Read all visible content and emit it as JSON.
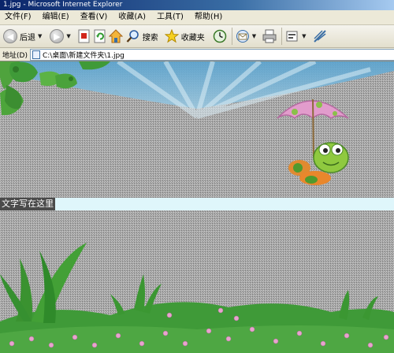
{
  "window": {
    "title": "1.jpg - Microsoft Internet Explorer"
  },
  "menu": {
    "items": [
      "文件(F)",
      "编辑(E)",
      "查看(V)",
      "收藏(A)",
      "工具(T)",
      "帮助(H)"
    ]
  },
  "toolbar": {
    "back_label": "后退",
    "search_label": "搜索",
    "favorites_label": "收藏夹"
  },
  "address": {
    "label": "地址(D)",
    "value": "C:\\桌面\\新建文件夹\\1.jpg"
  },
  "content": {
    "caption_text": "文字写在这里"
  },
  "colors": {
    "titlebar_start": "#0a246a",
    "sky": "#7fb8d8",
    "grass": "#3f9a38",
    "umbrella": "#d98fc6"
  }
}
